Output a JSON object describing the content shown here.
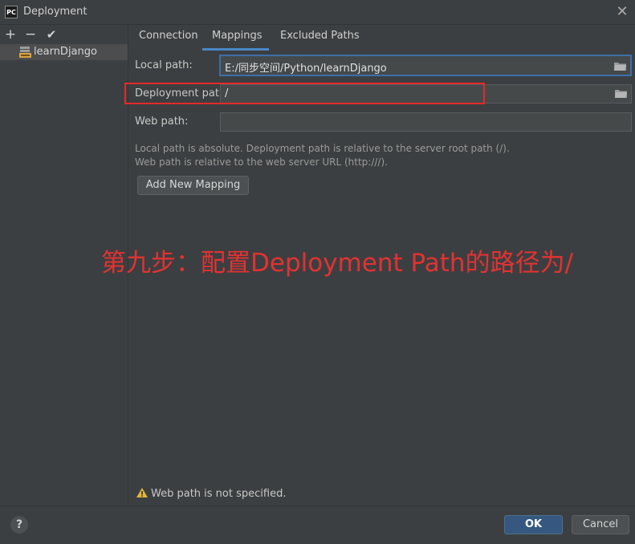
{
  "window": {
    "title": "Deployment",
    "app_badge": "PC",
    "close_glyph": "✕"
  },
  "toolbar": {
    "add": "+",
    "remove": "−",
    "check": "✔"
  },
  "servers": [
    {
      "name": "learnDjango",
      "icon": "sftp-server-icon"
    }
  ],
  "tabs": [
    {
      "label": "Connection"
    },
    {
      "label": "Mappings",
      "active": true
    },
    {
      "label": "Excluded Paths"
    }
  ],
  "mappings": {
    "local_path": {
      "label": "Local path:",
      "value": "E:/同步空间/Python/learnDjango"
    },
    "deployment_path": {
      "label": "Deployment path:",
      "value": "/"
    },
    "web_path": {
      "label": "Web path:",
      "value": ""
    },
    "hint_line1": "Local path is absolute. Deployment path is relative to the server root path (/).",
    "hint_line2": "Web path is relative to the web server URL (http:///).",
    "add_mapping_label": "Add New Mapping"
  },
  "annotation": "第九步：配置Deployment Path的路径为/",
  "warning": {
    "text": "Web path is not specified.",
    "icon": "warning-icon"
  },
  "footer": {
    "help": "?",
    "ok": "OK",
    "cancel": "Cancel"
  },
  "colors": {
    "accent": "#4a88c7",
    "annotation_red": "#e52929",
    "ok_button": "#365880",
    "background": "#3c3f41"
  }
}
